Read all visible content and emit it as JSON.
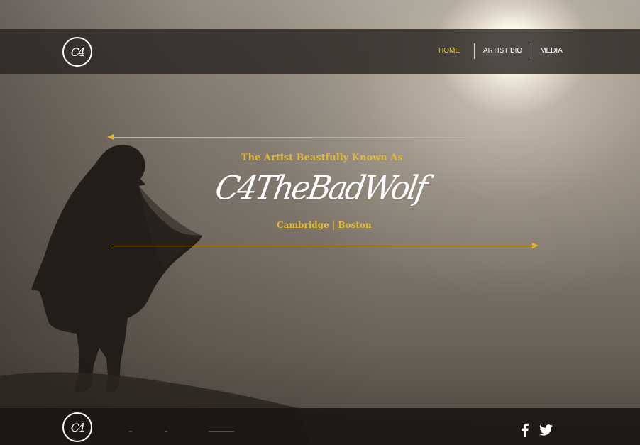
{
  "brand": {
    "logo_text": "C4"
  },
  "nav": {
    "items": [
      {
        "label": "HOME",
        "active": true
      },
      {
        "label": "ARTIST BIO",
        "active": false
      },
      {
        "label": "MEDIA",
        "active": false
      }
    ]
  },
  "hero": {
    "kicker": "The Artist Beastfully Known As",
    "title": "C4TheBadWolf",
    "location": "Cambridge | Boston"
  },
  "footer": {
    "logo_text": "C4",
    "social": [
      {
        "icon": "facebook-icon"
      },
      {
        "icon": "twitter-icon"
      }
    ]
  },
  "colors": {
    "accent": "#e6b92d",
    "header_bg": "#282421",
    "footer_bg": "#1a1613",
    "text_light": "#ffffff"
  }
}
